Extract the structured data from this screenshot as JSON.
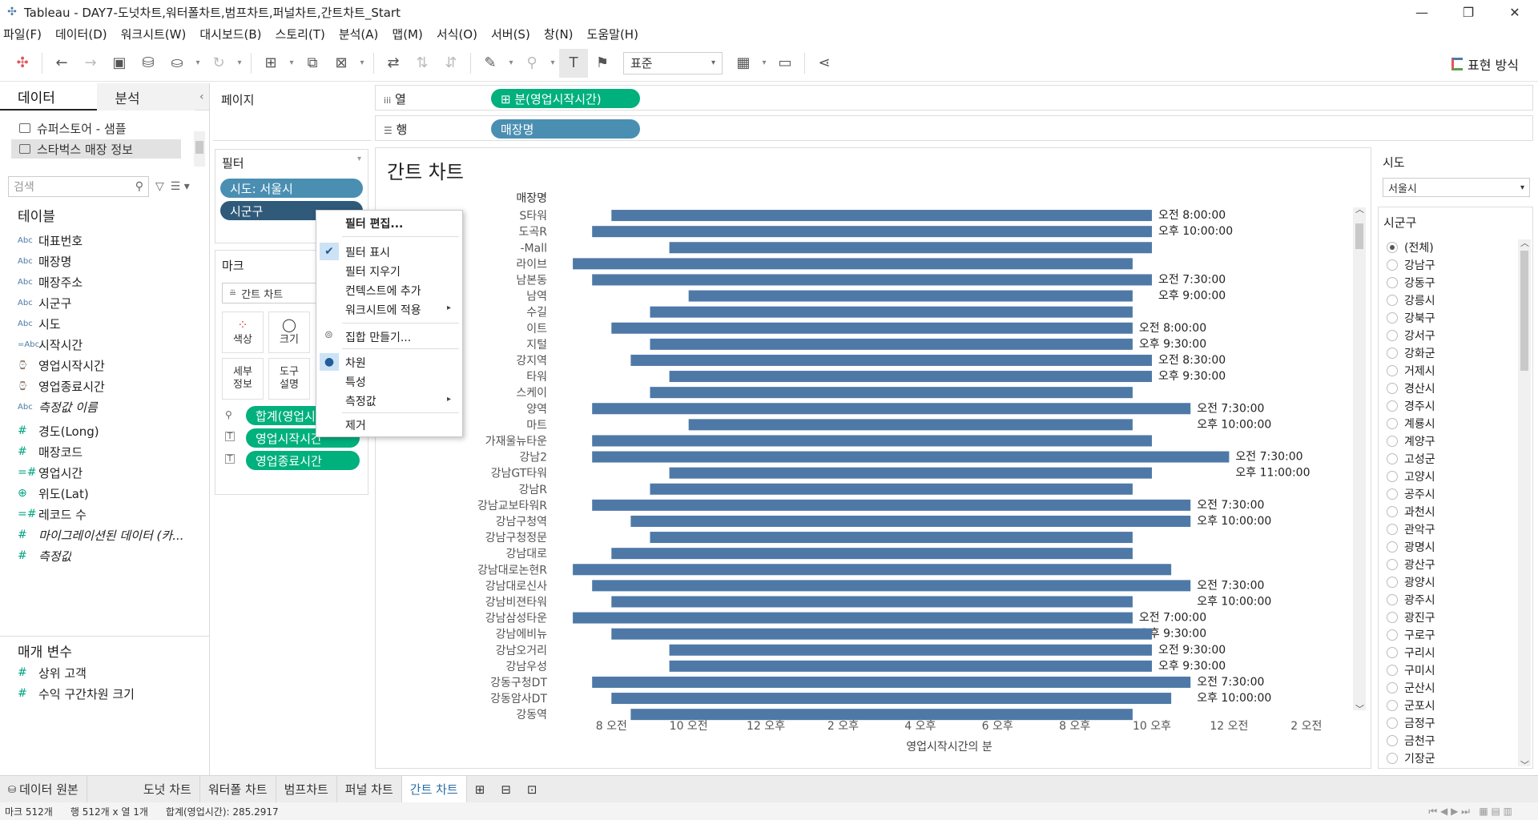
{
  "window": {
    "title": "Tableau - DAY7-도넛차트,워터폴차트,범프차트,퍼널차트,간트차트_Start",
    "minimize": "—",
    "restore": "❐",
    "close": "✕"
  },
  "menu": [
    "파일(F)",
    "데이터(D)",
    "워크시트(W)",
    "대시보드(B)",
    "스토리(T)",
    "분석(A)",
    "맵(M)",
    "서식(O)",
    "서버(S)",
    "창(N)",
    "도움말(H)"
  ],
  "toolbar": {
    "fit_select": "표준",
    "show_me": "표현 방식"
  },
  "data_pane": {
    "tabs": [
      "데이터",
      "분석"
    ],
    "datasources": [
      "슈퍼스토어 - 샘플",
      "스타벅스 매장 정보"
    ],
    "search_placeholder": "검색",
    "tables_title": "테이블",
    "dimensions": [
      {
        "type": "Abc",
        "name": "대표번호"
      },
      {
        "type": "Abc",
        "name": "매장명"
      },
      {
        "type": "Abc",
        "name": "매장주소"
      },
      {
        "type": "Abc",
        "name": "시군구"
      },
      {
        "type": "Abc",
        "name": "시도"
      },
      {
        "type": "=Abc",
        "name": "시작시간"
      },
      {
        "type": "⌚",
        "name": "영업시작시간"
      },
      {
        "type": "⌚",
        "name": "영업종료시간"
      },
      {
        "type": "Abc",
        "name": "측정값 이름"
      }
    ],
    "measures": [
      {
        "type": "#",
        "name": "경도(Long)"
      },
      {
        "type": "#",
        "name": "매장코드"
      },
      {
        "type": "=#",
        "name": "영업시간"
      },
      {
        "type": "⊕",
        "name": "위도(Lat)"
      },
      {
        "type": "=#",
        "name": "레코드 수"
      },
      {
        "type": "#",
        "name": "마이그레이션된 데이터 (카..."
      },
      {
        "type": "#",
        "name": "측정값"
      }
    ],
    "params_title": "매개 변수",
    "params": [
      {
        "type": "#",
        "name": "상위 고객"
      },
      {
        "type": "#",
        "name": "수익 구간차원 크기"
      }
    ]
  },
  "pages_title": "페이지",
  "filters": {
    "title": "필터",
    "pills": [
      "시도: 서울시",
      "시군구"
    ]
  },
  "marks": {
    "title": "마크",
    "type": "간트 차트",
    "buttons": [
      "색상",
      "크기",
      "세부\n정보",
      "도구\n설명"
    ],
    "pills": [
      "합계(영업시간)",
      "영업시작시간",
      "영업종료시간"
    ]
  },
  "shelves": {
    "columns_label": "열",
    "columns_pill": "⊞ 분(영업시작시간)",
    "rows_label": "행",
    "rows_pill": "매장명"
  },
  "context_menu": {
    "items": [
      "필터 편집...",
      "필터 표시",
      "필터 지우기",
      "컨텍스트에 추가",
      "워크시트에 적용",
      "집합 만들기...",
      "차원",
      "특성",
      "측정값",
      "제거"
    ]
  },
  "legend": {
    "sido_title": "시도",
    "sido_value": "서울시",
    "sigungu_title": "시군구",
    "sigungu_items": [
      "(전체)",
      "강남구",
      "강동구",
      "강릉시",
      "강북구",
      "강서구",
      "강화군",
      "거제시",
      "경산시",
      "경주시",
      "계룡시",
      "계양구",
      "고성군",
      "고양시",
      "공주시",
      "과천시",
      "관악구",
      "광명시",
      "광산구",
      "광양시",
      "광주시",
      "광진구",
      "구로구",
      "구리시",
      "구미시",
      "군산시",
      "군포시",
      "금정구",
      "금천구",
      "기장군"
    ]
  },
  "sheet_tabs": [
    "데이터 원본",
    "도넛 차트",
    "워터폴 차트",
    "범프차트",
    "퍼널 차트",
    "간트 차트"
  ],
  "status": {
    "marks": "마크 512개",
    "rows": "행 512개 x 열 1개",
    "sum": "합계(영업시간): 285.2917"
  },
  "chart_data": {
    "type": "bar",
    "title": "간트 차트",
    "row_header": "매장명",
    "xlabel": "영업시작시간의 분",
    "x_ticks": [
      "8 오전",
      "10 오전",
      "12 오후",
      "2 오후",
      "4 오후",
      "6 오후",
      "8 오후",
      "10 오후",
      "12 오전",
      "2 오전"
    ],
    "x_tick_hours": [
      8,
      10,
      12,
      14,
      16,
      18,
      20,
      22,
      24,
      26
    ],
    "xlim": [
      6.5,
      27
    ],
    "color": "#4e79a7",
    "rows": [
      {
        "label": "S타워",
        "start": 8,
        "end": 22,
        "labels": [
          "오전 8:00:00",
          "오후 10:00:00"
        ]
      },
      {
        "label": "도곡R",
        "start": 7.5,
        "end": 22,
        "labels": []
      },
      {
        "label": "-Mall",
        "start": 9.5,
        "end": 22,
        "labels": []
      },
      {
        "label": "라이브",
        "start": 7,
        "end": 21.5,
        "labels": []
      },
      {
        "label": "남본동",
        "start": 7.5,
        "end": 22,
        "labels": [
          "오전 7:30:00",
          "오후 9:00:00"
        ]
      },
      {
        "label": "남역",
        "start": 10,
        "end": 21.5,
        "labels": []
      },
      {
        "label": "수길",
        "start": 9,
        "end": 21.5,
        "labels": []
      },
      {
        "label": "이트",
        "start": 8,
        "end": 21.5,
        "labels": [
          "오전 8:00:00",
          "오후 9:30:00"
        ]
      },
      {
        "label": "지털",
        "start": 9,
        "end": 21.5,
        "labels": []
      },
      {
        "label": "강지역",
        "start": 8.5,
        "end": 22,
        "labels": [
          "오전 8:30:00",
          "오후 9:30:00"
        ]
      },
      {
        "label": "타워",
        "start": 9.5,
        "end": 22,
        "labels": []
      },
      {
        "label": "스케이",
        "start": 9,
        "end": 21.5,
        "labels": []
      },
      {
        "label": "양역",
        "start": 7.5,
        "end": 23,
        "labels": [
          "오전 7:30:00",
          "오후 10:00:00"
        ]
      },
      {
        "label": "마트",
        "start": 10,
        "end": 21.5,
        "labels": []
      },
      {
        "label": "가재울뉴타운",
        "start": 7.5,
        "end": 22,
        "labels": []
      },
      {
        "label": "강남2",
        "start": 7.5,
        "end": 24,
        "labels": [
          "오전 7:30:00",
          "오후 11:00:00"
        ]
      },
      {
        "label": "강남GT타워",
        "start": 9.5,
        "end": 22,
        "labels": []
      },
      {
        "label": "강남R",
        "start": 9,
        "end": 21.5,
        "labels": []
      },
      {
        "label": "강남교보타워R",
        "start": 7.5,
        "end": 23,
        "labels": [
          "오전 7:30:00",
          "오후 10:00:00"
        ]
      },
      {
        "label": "강남구청역",
        "start": 8.5,
        "end": 23,
        "labels": []
      },
      {
        "label": "강남구청정문",
        "start": 9,
        "end": 21.5,
        "labels": []
      },
      {
        "label": "강남대로",
        "start": 8,
        "end": 21.5,
        "labels": []
      },
      {
        "label": "강남대로논현R",
        "start": 7,
        "end": 22.5,
        "labels": []
      },
      {
        "label": "강남대로신사",
        "start": 7.5,
        "end": 23,
        "labels": [
          "오전 7:30:00",
          "오후 10:00:00"
        ]
      },
      {
        "label": "강남비젼타워",
        "start": 8,
        "end": 21.5,
        "labels": []
      },
      {
        "label": "강남삼성타운",
        "start": 7,
        "end": 21.5,
        "labels": [
          "오전 7:00:00",
          "오후 9:30:00"
        ]
      },
      {
        "label": "강남에비뉴",
        "start": 8,
        "end": 22,
        "labels": []
      },
      {
        "label": "강남오거리",
        "start": 9.5,
        "end": 22,
        "labels": [
          "오전 9:30:00",
          "오후 9:30:00"
        ]
      },
      {
        "label": "강남우성",
        "start": 9.5,
        "end": 22,
        "labels": []
      },
      {
        "label": "강동구청DT",
        "start": 7.5,
        "end": 23,
        "labels": [
          "오전 7:30:00",
          "오후 10:00:00"
        ]
      },
      {
        "label": "강동암사DT",
        "start": 8,
        "end": 22.5,
        "labels": []
      },
      {
        "label": "강동역",
        "start": 8.5,
        "end": 21.5,
        "labels": []
      }
    ]
  }
}
